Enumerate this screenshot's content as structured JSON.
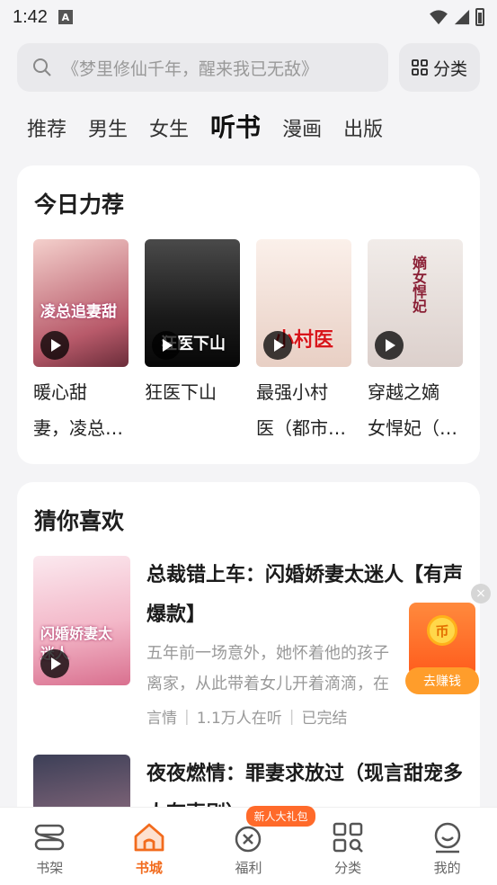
{
  "status_bar": {
    "time": "1:42",
    "notification_icon": "A"
  },
  "search": {
    "placeholder": "《梦里修仙千年，醒来我已无敌》"
  },
  "category_button": {
    "label": "分类"
  },
  "tabs": [
    {
      "label": "推荐",
      "active": false
    },
    {
      "label": "男生",
      "active": false
    },
    {
      "label": "女生",
      "active": false
    },
    {
      "label": "听书",
      "active": true
    },
    {
      "label": "漫画",
      "active": false
    },
    {
      "label": "出版",
      "active": false
    }
  ],
  "recommend": {
    "title": "今日力荐",
    "items": [
      {
        "name_line1": "暖心甜",
        "name_line2": "妻，凌总…",
        "cover_text": "凌总追妻甜",
        "cover_colors": [
          "#f2c6c4",
          "#6b2d3a"
        ]
      },
      {
        "name_line1": "狂医下山",
        "name_line2": "",
        "cover_text": "狂医下山",
        "cover_colors": [
          "#3a3a3a",
          "#0d0d0d"
        ]
      },
      {
        "name_line1": "最强小村",
        "name_line2": "医（都市…",
        "cover_text": "小村医",
        "cover_colors": [
          "#f7e6dc",
          "#d4c0b6"
        ]
      },
      {
        "name_line1": "穿越之嫡",
        "name_line2": "女悍妃（…",
        "cover_text": "嫡女悍妃",
        "cover_colors": [
          "#ece5e2",
          "#d6cbc7"
        ]
      }
    ]
  },
  "guess": {
    "title": "猜你喜欢",
    "items": [
      {
        "title": "总裁错上车：闪婚娇妻太迷人【有声爆款】",
        "desc_line1": "五年前一场意外，她怀着他的孩子",
        "desc_line2": "离家，从此带着女儿开着滴滴，在",
        "genre": "言情",
        "listeners": "1.1万人在听",
        "status": "已完结",
        "cover_text": "闪婚娇妻太迷人"
      },
      {
        "title": "夜夜燃情：罪妻求放过（现言甜宠多人有声剧）"
      }
    ]
  },
  "float_ad": {
    "close": "×",
    "label": "去赚钱",
    "coin": "币"
  },
  "bottom_nav": {
    "badge": "新人大礼包",
    "items": [
      {
        "label": "书架",
        "icon": "bookshelf-icon",
        "active": false
      },
      {
        "label": "书城",
        "icon": "home-icon",
        "active": true
      },
      {
        "label": "福利",
        "icon": "gift-icon",
        "active": false
      },
      {
        "label": "分类",
        "icon": "category-icon",
        "active": false
      },
      {
        "label": "我的",
        "icon": "profile-icon",
        "active": false
      }
    ]
  },
  "colors": {
    "accent": "#f26b1d",
    "background": "#f4f4f6"
  }
}
